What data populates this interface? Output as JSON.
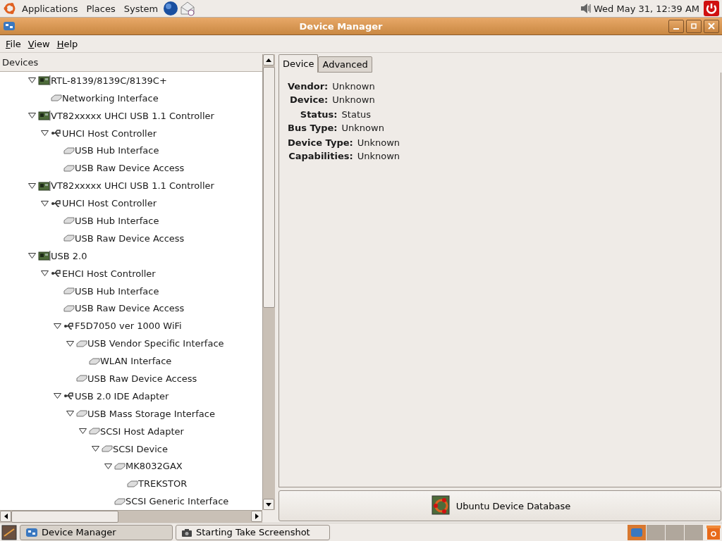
{
  "top_panel": {
    "menus": [
      "Applications",
      "Places",
      "System"
    ],
    "clock": "Wed May 31, 12:39 AM"
  },
  "window": {
    "title": "Device Manager"
  },
  "menu_bar": [
    {
      "mnemonic": "F",
      "rest": "ile"
    },
    {
      "mnemonic": "V",
      "rest": "iew"
    },
    {
      "mnemonic": "H",
      "rest": "elp"
    }
  ],
  "tree": {
    "header": "Devices",
    "items": [
      {
        "label": "RTL-8139/8139C/8139C+",
        "kind": "card",
        "expanded": true,
        "children": [
          {
            "label": "Networking Interface",
            "kind": "leaf"
          }
        ]
      },
      {
        "label": "VT82xxxxx UHCI USB 1.1 Controller",
        "kind": "card",
        "expanded": true,
        "children": [
          {
            "label": "UHCI Host Controller",
            "kind": "usb",
            "expanded": true,
            "children": [
              {
                "label": "USB Hub Interface",
                "kind": "leaf"
              },
              {
                "label": "USB Raw Device Access",
                "kind": "leaf"
              }
            ]
          }
        ]
      },
      {
        "label": "VT82xxxxx UHCI USB 1.1 Controller",
        "kind": "card",
        "expanded": true,
        "children": [
          {
            "label": "UHCI Host Controller",
            "kind": "usb",
            "expanded": true,
            "children": [
              {
                "label": "USB Hub Interface",
                "kind": "leaf"
              },
              {
                "label": "USB Raw Device Access",
                "kind": "leaf"
              }
            ]
          }
        ]
      },
      {
        "label": "USB 2.0",
        "kind": "card",
        "expanded": true,
        "children": [
          {
            "label": "EHCI Host Controller",
            "kind": "usb",
            "expanded": true,
            "children": [
              {
                "label": "USB Hub Interface",
                "kind": "leaf"
              },
              {
                "label": "USB Raw Device Access",
                "kind": "leaf"
              },
              {
                "label": "F5D7050 ver 1000 WiFi",
                "kind": "usb",
                "expanded": true,
                "children": [
                  {
                    "label": "USB Vendor Specific Interface",
                    "kind": "leaf",
                    "expanded": true,
                    "children": [
                      {
                        "label": "WLAN Interface",
                        "kind": "leaf"
                      }
                    ]
                  },
                  {
                    "label": "USB Raw Device Access",
                    "kind": "leaf"
                  }
                ]
              },
              {
                "label": "USB 2.0 IDE Adapter",
                "kind": "usb",
                "expanded": true,
                "children": [
                  {
                    "label": "USB Mass Storage Interface",
                    "kind": "leaf",
                    "expanded": true,
                    "children": [
                      {
                        "label": "SCSI Host Adapter",
                        "kind": "leaf",
                        "expanded": true,
                        "children": [
                          {
                            "label": "SCSI Device",
                            "kind": "leaf",
                            "expanded": true,
                            "children": [
                              {
                                "label": "MK8032GAX",
                                "kind": "leaf",
                                "expanded": true,
                                "children": [
                                  {
                                    "label": "TREKSTOR",
                                    "kind": "leaf"
                                  }
                                ]
                              },
                              {
                                "label": "SCSI Generic Interface",
                                "kind": "leaf"
                              }
                            ]
                          }
                        ]
                      }
                    ]
                  }
                ]
              }
            ]
          }
        ]
      }
    ]
  },
  "tabs": [
    {
      "label": "Device",
      "selected": true
    },
    {
      "label": "Advanced",
      "selected": false
    }
  ],
  "properties": [
    [
      {
        "label": "Vendor:",
        "value": "Unknown"
      },
      {
        "label": "Device:",
        "value": "Unknown"
      }
    ],
    [
      {
        "label": "Status:",
        "value": "Status"
      },
      {
        "label": "Bus Type:",
        "value": "Unknown"
      }
    ],
    [
      {
        "label": "Device Type:",
        "value": "Unknown"
      },
      {
        "label": "Capabilities:",
        "value": "Unknown"
      }
    ]
  ],
  "database_button": "Ubuntu Device Database",
  "taskbar": [
    {
      "label": "Device Manager",
      "kind": "app",
      "selected": true
    },
    {
      "label": "Starting Take Screenshot",
      "kind": "camera",
      "selected": false
    }
  ]
}
